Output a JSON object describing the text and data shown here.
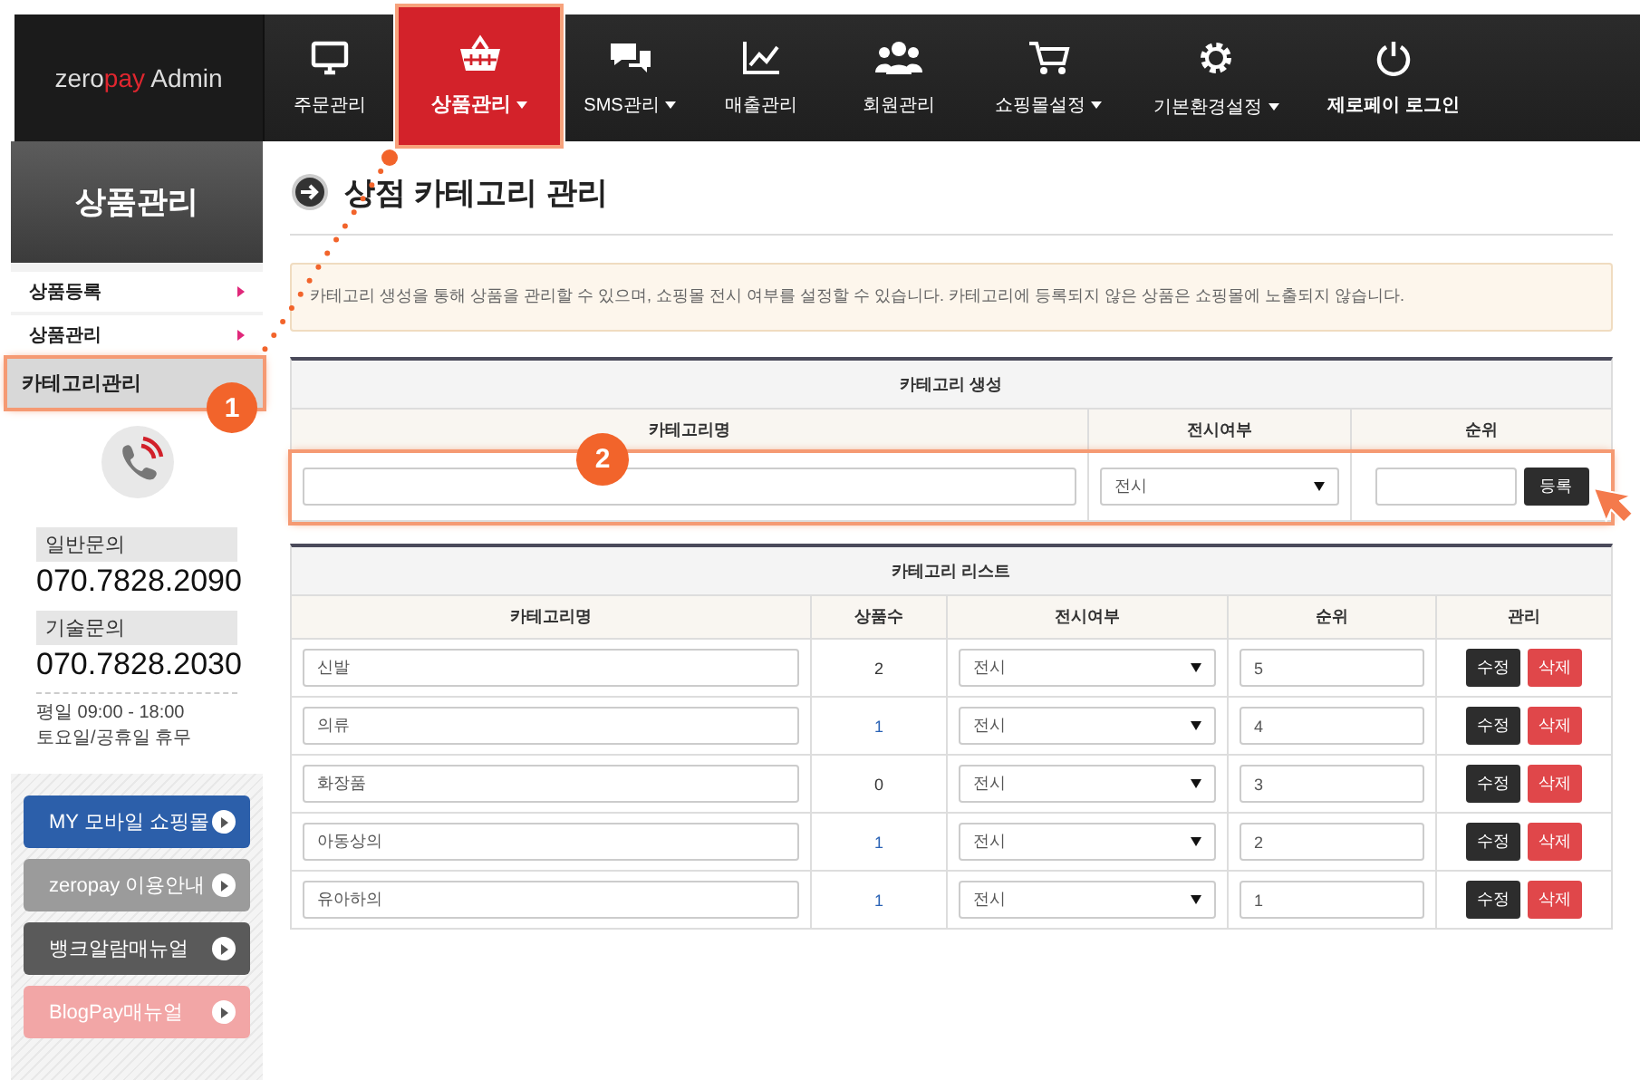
{
  "logo": {
    "brand": "zero",
    "brand_accent": "pay",
    "suffix": "Admin"
  },
  "nav": [
    {
      "label": "주문관리",
      "selected": false,
      "dropdown": false
    },
    {
      "label": "상품관리",
      "selected": true,
      "dropdown": true
    },
    {
      "label": "SMS관리",
      "selected": false,
      "dropdown": true
    },
    {
      "label": "매출관리",
      "selected": false,
      "dropdown": false
    },
    {
      "label": "회원관리",
      "selected": false,
      "dropdown": false
    },
    {
      "label": "쇼핑몰설정",
      "selected": false,
      "dropdown": true
    },
    {
      "label": "기본환경설정",
      "selected": false,
      "dropdown": true
    },
    {
      "label": "제로페이 로그인",
      "selected": false,
      "dropdown": false
    }
  ],
  "sidebar": {
    "title": "상품관리",
    "menu": [
      {
        "label": "상품등록",
        "selected": false,
        "highlighted": false
      },
      {
        "label": "상품관리",
        "selected": false,
        "highlighted": false
      },
      {
        "label": "카테고리관리",
        "selected": true,
        "highlighted": true,
        "badge": "1"
      }
    ],
    "contacts": [
      {
        "label": "일반문의",
        "phone": "070.7828.2090"
      },
      {
        "label": "기술문의",
        "phone": "070.7828.2030"
      }
    ],
    "hours": [
      "평일 09:00 - 18:00",
      "토요일/공휴일 휴무"
    ],
    "buttons": [
      {
        "label": "MY 모바일 쇼핑몰",
        "color": "#2c5faa"
      },
      {
        "label": "zeropay 이용안내",
        "color": "#9b9b9b"
      },
      {
        "label": "뱅크알람매뉴얼",
        "color": "#5a5a5a"
      },
      {
        "label": "BlogPay매뉴얼",
        "color": "#f2a6a6"
      }
    ]
  },
  "page": {
    "title": "상점 카테고리 관리",
    "notice": "카테고리 생성을 통해 상품을 관리할 수 있으며, 쇼핑몰 전시 여부를 설정할 수 있습니다. 카테고리에 등록되지 않은 상품은 쇼핑몰에 노출되지 않습니다."
  },
  "create_form": {
    "title": "카테고리 생성",
    "columns": [
      "카테고리명",
      "전시여부",
      "순위"
    ],
    "display_select": "전시",
    "submit": "등록",
    "highlighted": true,
    "badge": "2"
  },
  "category_list": {
    "title": "카테고리 리스트",
    "columns": [
      "카테고리명",
      "상품수",
      "전시여부",
      "순위",
      "관리"
    ],
    "rows": [
      {
        "name": "신발",
        "count": "2",
        "count_link": false,
        "display": "전시",
        "rank": "5",
        "edit": "수정",
        "delete": "삭제"
      },
      {
        "name": "의류",
        "count": "1",
        "count_link": true,
        "display": "전시",
        "rank": "4",
        "edit": "수정",
        "delete": "삭제"
      },
      {
        "name": "화장품",
        "count": "0",
        "count_link": false,
        "display": "전시",
        "rank": "3",
        "edit": "수정",
        "delete": "삭제"
      },
      {
        "name": "아동상의",
        "count": "1",
        "count_link": true,
        "display": "전시",
        "rank": "2",
        "edit": "수정",
        "delete": "삭제"
      },
      {
        "name": "유아하의",
        "count": "1",
        "count_link": true,
        "display": "전시",
        "rank": "1",
        "edit": "수정",
        "delete": "삭제"
      }
    ]
  }
}
